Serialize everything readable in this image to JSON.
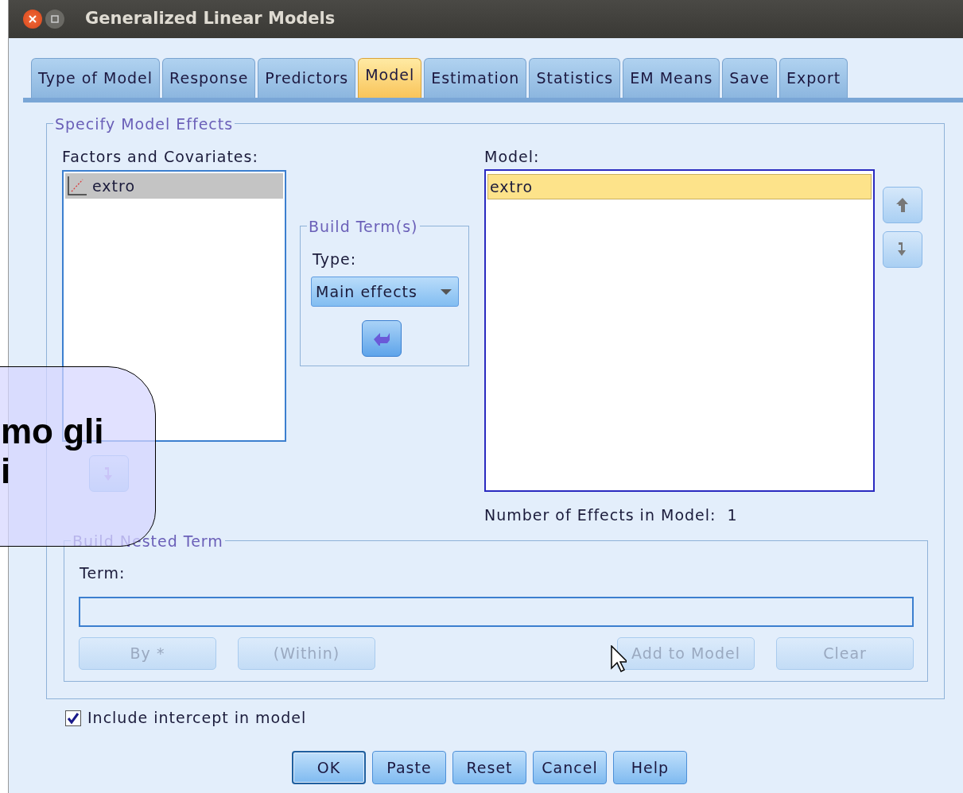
{
  "window": {
    "title": "Generalized Linear Models"
  },
  "tabs": [
    {
      "label": "Type of Model",
      "selected": false
    },
    {
      "label": "Response",
      "selected": false
    },
    {
      "label": "Predictors",
      "selected": false
    },
    {
      "label": "Model",
      "selected": true
    },
    {
      "label": "Estimation",
      "selected": false
    },
    {
      "label": "Statistics",
      "selected": false
    },
    {
      "label": "EM Means",
      "selected": false
    },
    {
      "label": "Save",
      "selected": false
    },
    {
      "label": "Export",
      "selected": false
    }
  ],
  "model_effects": {
    "title": "Specify Model Effects",
    "factors": {
      "label": "Factors and Covariates:",
      "items": [
        {
          "label": "extro",
          "kind": "scale",
          "selected": true
        }
      ]
    },
    "build_terms": {
      "title": "Build Term(s)",
      "type_label": "Type:",
      "type_value": "Main effects"
    },
    "model": {
      "label": "Model:",
      "items": [
        {
          "label": "extro",
          "selected": true
        }
      ]
    },
    "effects_count": {
      "label": "Number of Effects in Model:",
      "value": "1"
    }
  },
  "nested_term": {
    "title": "Build Nested Term",
    "term_label": "Term:",
    "buttons": [
      {
        "label": "By *",
        "disabled": true
      },
      {
        "label": "(Within)",
        "disabled": true
      },
      {
        "label": "Add to Model",
        "disabled": true
      },
      {
        "label": "Clear",
        "disabled": true
      }
    ]
  },
  "include_intercept": {
    "label": "Include intercept in model",
    "checked": true
  },
  "buttons": [
    {
      "label": "OK",
      "default": true
    },
    {
      "label": "Paste",
      "default": false
    },
    {
      "label": "Reset",
      "default": false
    },
    {
      "label": "Cancel",
      "default": false
    },
    {
      "label": "Help",
      "default": false
    }
  ],
  "callout": {
    "lines": [
      "mo gli",
      "i"
    ]
  }
}
